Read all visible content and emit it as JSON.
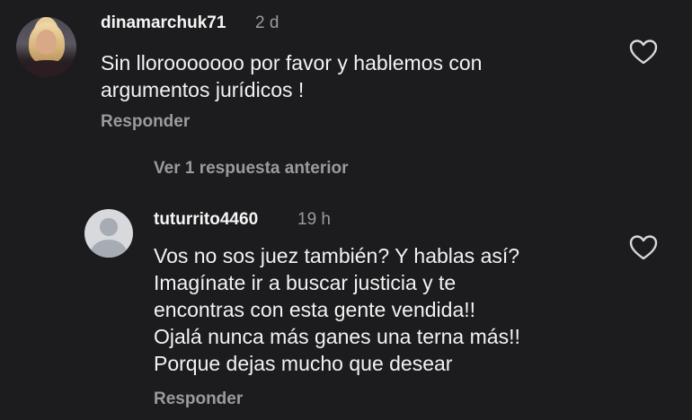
{
  "comments": [
    {
      "username": "dinamarchuk71",
      "time": "2 d",
      "text_lines": [
        "Sin llorooooooo por favor y hablemos con",
        "argumentos jurídicos !"
      ],
      "reply_label": "Responder",
      "avatar": "profile-photo",
      "like_icon": "heart-outline-icon"
    }
  ],
  "view_replies_label": "Ver 1 respuesta anterior",
  "replies": [
    {
      "username": "tuturrito4460",
      "time": "19 h",
      "text_lines": [
        "Vos no sos juez también? Y hablas así?",
        "Imagínate ir a buscar justicia y te",
        "encontras con esta gente vendida!!",
        "Ojalá nunca más ganes una terna más!!",
        "Porque dejas mucho que desear"
      ],
      "reply_label": "Responder",
      "avatar": "default-avatar",
      "like_icon": "heart-outline-icon"
    }
  ],
  "colors": {
    "background": "#1c1c1e",
    "text": "#f2f2f2",
    "muted": "#9a9a9f"
  }
}
